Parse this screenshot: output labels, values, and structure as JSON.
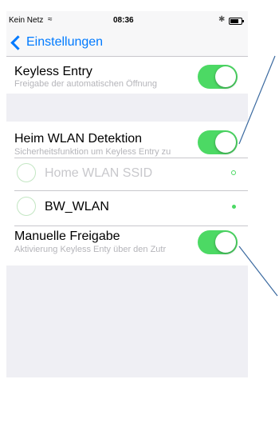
{
  "status_bar": {
    "carrier": "Kein Netz",
    "time": "08:36"
  },
  "nav": {
    "back_label": "Einstellungen"
  },
  "keyless": {
    "title": "Keyless Entry",
    "subtitle": "Freigabe der automatischen Öffnung",
    "enabled": true
  },
  "wlan": {
    "title": "Heim WLAN Detektion",
    "subtitle": "Sicherheitsfunktion um Keyless Entry zu",
    "enabled": true
  },
  "ssids": [
    {
      "name": "Home WLAN SSID",
      "status": "hollow"
    },
    {
      "name": "BW_WLAN",
      "status": "connected"
    }
  ],
  "manual": {
    "title": "Manuelle Freigabe",
    "subtitle": "Aktivierung Keyless Enty über den Zutr",
    "enabled": true
  },
  "colors": {
    "accent": "#007aff",
    "toggle_on": "#4cd964",
    "callout": "#3b6aa0"
  }
}
